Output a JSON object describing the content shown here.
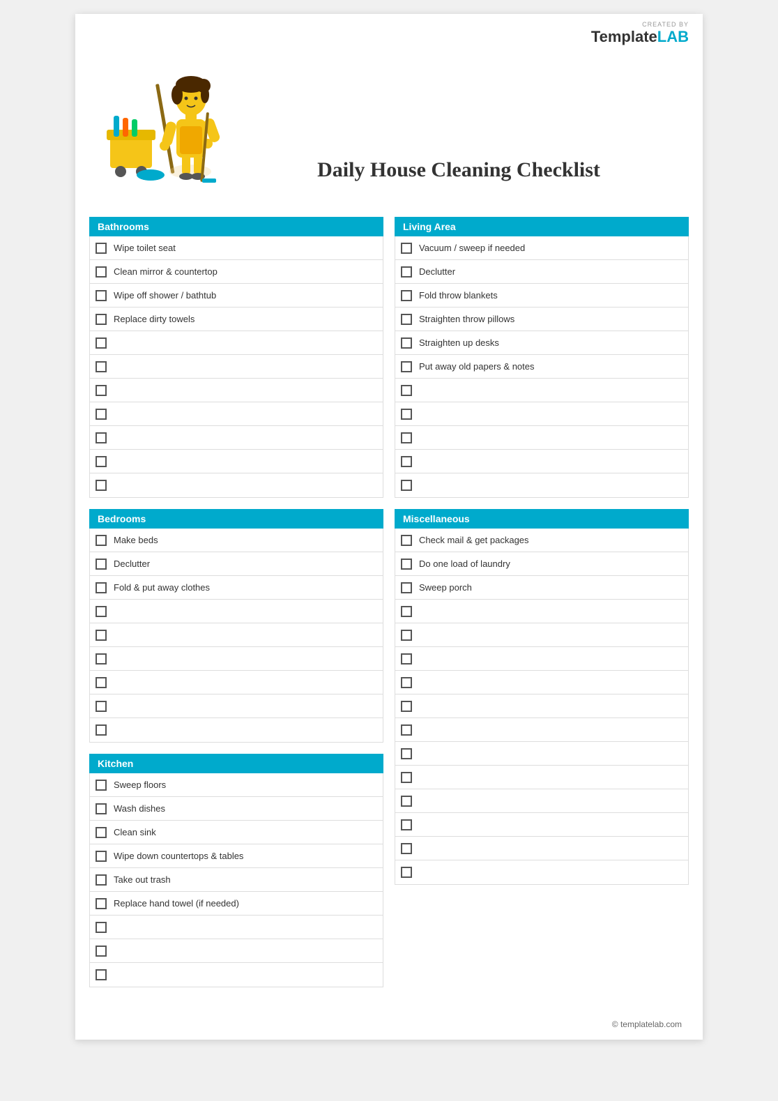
{
  "brand": {
    "created_by": "CREATED BY",
    "name_part1": "Template",
    "name_part2": "LAB"
  },
  "title": "Daily House Cleaning Checklist",
  "footer": "© templatelab.com",
  "sections": {
    "left": [
      {
        "id": "bathrooms",
        "header": "Bathrooms",
        "items": [
          "Wipe toilet seat",
          "Clean mirror & countertop",
          "Wipe off shower / bathtub",
          "Replace dirty towels",
          "",
          "",
          "",
          "",
          "",
          "",
          ""
        ]
      },
      {
        "id": "bedrooms",
        "header": "Bedrooms",
        "items": [
          "Make beds",
          "Declutter",
          "Fold & put away clothes",
          "",
          "",
          "",
          "",
          "",
          ""
        ]
      },
      {
        "id": "kitchen",
        "header": "Kitchen",
        "items": [
          "Sweep floors",
          "Wash dishes",
          "Clean sink",
          "Wipe down countertops & tables",
          "Take out trash",
          "Replace hand towel (if needed)",
          "",
          "",
          ""
        ]
      }
    ],
    "right": [
      {
        "id": "living-area",
        "header": "Living Area",
        "items": [
          "Vacuum / sweep if needed",
          "Declutter",
          "Fold throw blankets",
          "Straighten throw pillows",
          "Straighten up desks",
          "Put away old papers & notes",
          "",
          "",
          "",
          "",
          ""
        ]
      },
      {
        "id": "miscellaneous",
        "header": "Miscellaneous",
        "items": [
          "Check mail & get packages",
          "Do one load of laundry",
          "Sweep porch",
          "",
          "",
          "",
          "",
          "",
          "",
          "",
          "",
          "",
          "",
          "",
          ""
        ]
      }
    ]
  }
}
